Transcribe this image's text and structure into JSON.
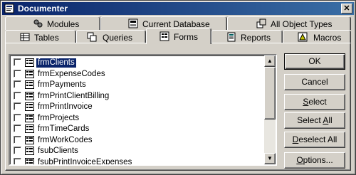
{
  "window": {
    "title": "Documenter",
    "close_glyph": "✕"
  },
  "tabs_back": [
    {
      "label": "Modules",
      "icon": "modules-icon"
    },
    {
      "label": "Current Database",
      "icon": "current-database-icon"
    },
    {
      "label": "All Object Types",
      "icon": "all-object-types-icon"
    }
  ],
  "tabs_front": [
    {
      "label": "Tables",
      "icon": "tables-icon"
    },
    {
      "label": "Queries",
      "icon": "queries-icon"
    },
    {
      "label": "Forms",
      "icon": "forms-icon",
      "active": true
    },
    {
      "label": "Reports",
      "icon": "reports-icon"
    },
    {
      "label": "Macros",
      "icon": "macros-icon"
    }
  ],
  "list": {
    "selected_index": 0,
    "items": [
      {
        "label": "frmClients",
        "checked": false
      },
      {
        "label": "frmExpenseCodes",
        "checked": false
      },
      {
        "label": "frmPayments",
        "checked": false
      },
      {
        "label": "frmPrintClientBilling",
        "checked": false
      },
      {
        "label": "frmPrintInvoice",
        "checked": false
      },
      {
        "label": "frmProjects",
        "checked": false
      },
      {
        "label": "frmTimeCards",
        "checked": false
      },
      {
        "label": "frmWorkCodes",
        "checked": false
      },
      {
        "label": "fsubClients",
        "checked": false
      },
      {
        "label": "fsubPrintInvoiceExpenses",
        "checked": false
      }
    ]
  },
  "scrollbar": {
    "up_glyph": "▲",
    "down_glyph": "▼"
  },
  "buttons": {
    "ok": "OK",
    "cancel": "Cancel",
    "select": {
      "accel": "S",
      "rest": "elect"
    },
    "select_all": {
      "pre": "Select ",
      "accel": "A",
      "rest": "ll"
    },
    "deselect_all": {
      "accel": "D",
      "rest": "eselect All"
    },
    "options": {
      "accel": "O",
      "rest": "ptions..."
    }
  },
  "colors": {
    "face": "#d4d0c8",
    "selection": "#0a246a",
    "title_start": "#0a246a",
    "title_end": "#3a6ea5"
  }
}
